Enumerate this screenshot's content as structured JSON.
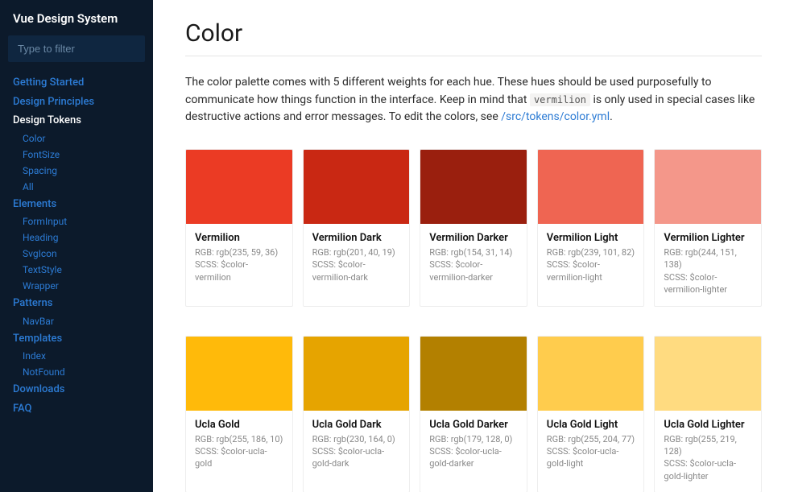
{
  "sidebar": {
    "title": "Vue Design System",
    "filter_placeholder": "Type to filter",
    "nav": [
      {
        "label": "Getting Started",
        "type": "heading"
      },
      {
        "label": "Design Principles",
        "type": "heading"
      },
      {
        "label": "Design Tokens",
        "type": "heading",
        "active": true,
        "children": [
          {
            "label": "Color"
          },
          {
            "label": "FontSize"
          },
          {
            "label": "Spacing"
          },
          {
            "label": "All"
          }
        ]
      },
      {
        "label": "Elements",
        "type": "heading",
        "children": [
          {
            "label": "FormInput"
          },
          {
            "label": "Heading"
          },
          {
            "label": "SvgIcon"
          },
          {
            "label": "TextStyle"
          },
          {
            "label": "Wrapper"
          }
        ]
      },
      {
        "label": "Patterns",
        "type": "heading",
        "children": [
          {
            "label": "NavBar"
          }
        ]
      },
      {
        "label": "Templates",
        "type": "heading",
        "children": [
          {
            "label": "Index"
          },
          {
            "label": "NotFound"
          }
        ]
      },
      {
        "label": "Downloads",
        "type": "heading"
      },
      {
        "label": "FAQ",
        "type": "heading"
      }
    ]
  },
  "page": {
    "title": "Color",
    "desc_1": "The color palette comes with 5 different weights for each hue. These hues should be used purposefully to communicate how things function in the interface. Keep in mind that ",
    "desc_code": "vermilion",
    "desc_2": " is only used in special cases like destructive actions and error messages. To edit the colors, see ",
    "desc_link": "/src/tokens/color.yml",
    "desc_3": "."
  },
  "swatch_groups": [
    [
      {
        "name": "Vermilion",
        "rgb": "rgb(235, 59, 36)",
        "scss": "$color-vermilion",
        "hex": "#eb3b24"
      },
      {
        "name": "Vermilion Dark",
        "rgb": "rgb(201, 40, 19)",
        "scss": "$color-vermilion-dark",
        "hex": "#c92813"
      },
      {
        "name": "Vermilion Darker",
        "rgb": "rgb(154, 31, 14)",
        "scss": "$color-vermilion-darker",
        "hex": "#9a1f0e"
      },
      {
        "name": "Vermilion Light",
        "rgb": "rgb(239, 101, 82)",
        "scss": "$color-vermilion-light",
        "hex": "#ef6552"
      },
      {
        "name": "Vermilion Lighter",
        "rgb": "rgb(244, 151, 138)",
        "scss": "$color-vermilion-lighter",
        "hex": "#f4978a"
      }
    ],
    [
      {
        "name": "Ucla Gold",
        "rgb": "rgb(255, 186, 10)",
        "scss": "$color-ucla-gold",
        "hex": "#ffba0a"
      },
      {
        "name": "Ucla Gold Dark",
        "rgb": "rgb(230, 164, 0)",
        "scss": "$color-ucla-gold-dark",
        "hex": "#e6a400"
      },
      {
        "name": "Ucla Gold Darker",
        "rgb": "rgb(179, 128, 0)",
        "scss": "$color-ucla-gold-darker",
        "hex": "#b38000"
      },
      {
        "name": "Ucla Gold Light",
        "rgb": "rgb(255, 204, 77)",
        "scss": "$color-ucla-gold-light",
        "hex": "#ffcc4d"
      },
      {
        "name": "Ucla Gold Lighter",
        "rgb": "rgb(255, 219, 128)",
        "scss": "$color-ucla-gold-lighter",
        "hex": "#ffdb80"
      }
    ]
  ]
}
